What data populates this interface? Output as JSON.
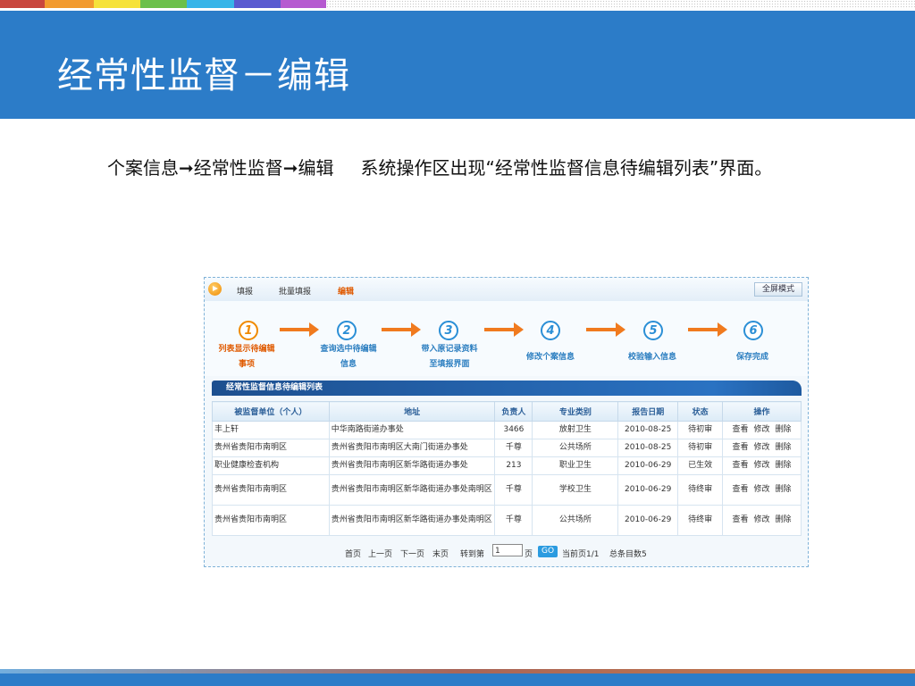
{
  "slide": {
    "title": "经常性监督－编辑",
    "desc_part1": "个案信息➞经常性监督➞编辑",
    "desc_part2": "系统操作区出现“经常性监督信息待编辑列表”界面。",
    "top_stripe_colors": [
      "#c9463d",
      "#f29a2e",
      "#f6e23a",
      "#6cc04a",
      "#38b5e8",
      "#5a5ad0",
      "#b65ad0"
    ]
  },
  "toolbar": {
    "fill": "填报",
    "batch_fill": "批量填报",
    "edit": "编辑",
    "fullscreen": "全屏模式"
  },
  "steps": [
    {
      "num": "1",
      "line1": "列表显示待编辑",
      "line2": "事项"
    },
    {
      "num": "2",
      "line1": "查询选中待编辑",
      "line2": "信息"
    },
    {
      "num": "3",
      "line1": "带入原记录资料",
      "line2": "至填报界面"
    },
    {
      "num": "4",
      "line1": "修改个案信息",
      "line2": ""
    },
    {
      "num": "5",
      "line1": "校验输入信息",
      "line2": ""
    },
    {
      "num": "6",
      "line1": "保存完成",
      "line2": ""
    }
  ],
  "list": {
    "title": "经常性监督信息待编辑列表",
    "columns": [
      "被监督单位（个人）",
      "地址",
      "负责人",
      "专业类别",
      "报告日期",
      "状态",
      "操作"
    ],
    "rows": [
      {
        "unit": "丰上轩",
        "addr": "中华南路街道办事处",
        "person": "3466",
        "cat": "放射卫生",
        "date": "2010-08-25",
        "status": "待初审"
      },
      {
        "unit": "贵州省贵阳市南明区",
        "addr": "贵州省贵阳市南明区大南门街道办事处",
        "person": "千尊",
        "cat": "公共场所",
        "date": "2010-08-25",
        "status": "待初审"
      },
      {
        "unit": "职业健康检查机构",
        "addr": "贵州省贵阳市南明区新华路街道办事处",
        "person": "213",
        "cat": "职业卫生",
        "date": "2010-06-29",
        "status": "已生效"
      },
      {
        "unit": "贵州省贵阳市南明区",
        "addr": "贵州省贵阳市南明区新华路街道办事处南明区",
        "person": "千尊",
        "cat": "学校卫生",
        "date": "2010-06-29",
        "status": "待终审"
      },
      {
        "unit": "贵州省贵阳市南明区",
        "addr": "贵州省贵阳市南明区新华路街道办事处南明区",
        "person": "千尊",
        "cat": "公共场所",
        "date": "2010-06-29",
        "status": "待终审"
      }
    ],
    "ops": [
      "查看",
      "修改",
      "删除"
    ]
  },
  "pager": {
    "first": "首页",
    "prev": "上一页",
    "next": "下一页",
    "last": "末页",
    "goto": "转到第",
    "page_value": "1",
    "page_unit": "页",
    "go": "GO",
    "current": "当前页1/1",
    "total": "总条目数5"
  }
}
